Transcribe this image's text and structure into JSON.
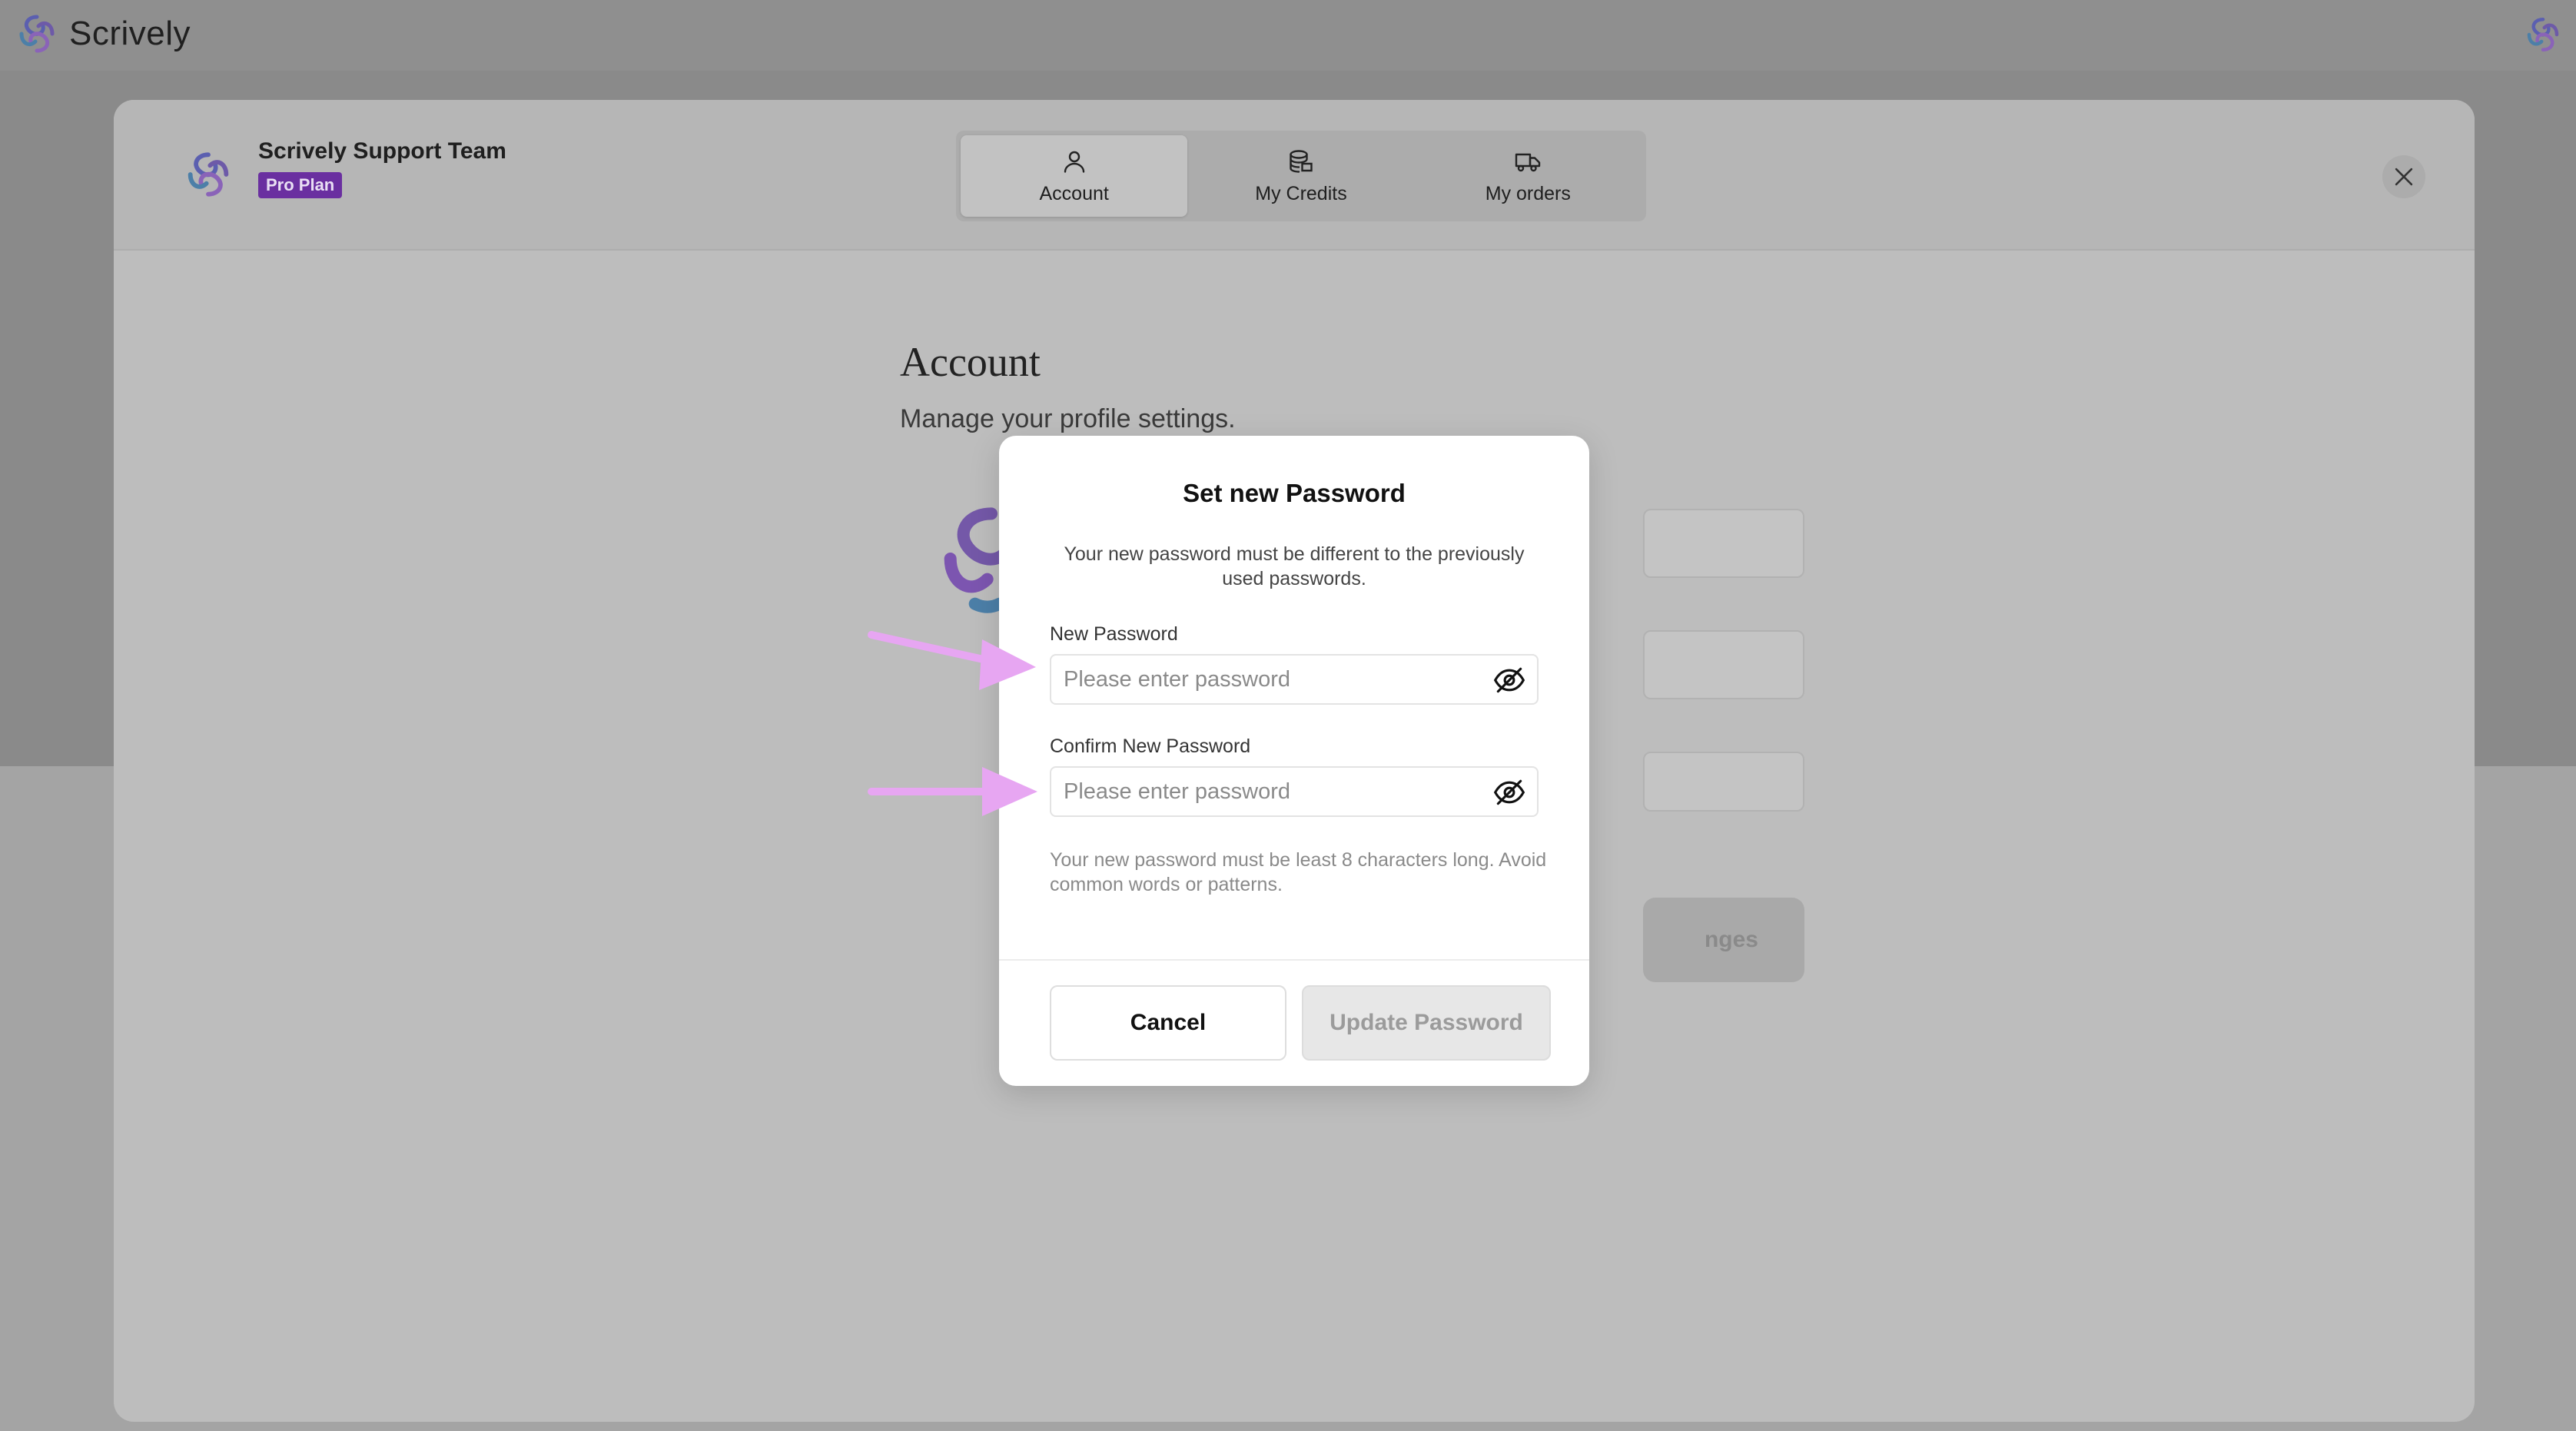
{
  "app": {
    "brand": "Scrively"
  },
  "settings": {
    "profile": {
      "name": "Scrively Support Team",
      "plan": "Pro Plan"
    },
    "tabs": [
      {
        "label": "Account",
        "icon": "user-icon",
        "active": true
      },
      {
        "label": "My Credits",
        "icon": "coins-icon",
        "active": false
      },
      {
        "label": "My orders",
        "icon": "truck-icon",
        "active": false
      }
    ],
    "page_title": "Account",
    "page_subtitle": "Manage your profile settings.",
    "save_button_partial": "nges"
  },
  "dialog": {
    "title": "Set new Password",
    "description": "Your new password must be different to the previously used passwords.",
    "new_password": {
      "label": "New Password",
      "placeholder": "Please enter password",
      "value": ""
    },
    "confirm_password": {
      "label": "Confirm New Password",
      "placeholder": "Please enter password",
      "value": ""
    },
    "hint": "Your new password must be least 8 characters long. Avoid common words or patterns.",
    "cancel_label": "Cancel",
    "update_label": "Update Password"
  },
  "colors": {
    "plan_badge": "#6a2fa0",
    "annotation_arrow": "#e7a6f2"
  }
}
